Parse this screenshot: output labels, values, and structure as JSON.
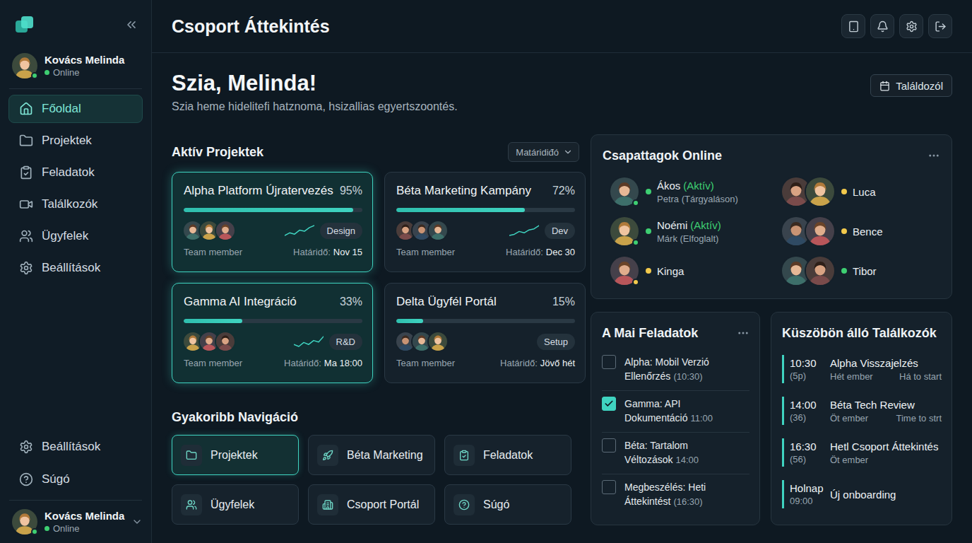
{
  "header": {
    "title": "Csoport Áttekintés"
  },
  "sidebar": {
    "user": {
      "name": "Kovács Melinda",
      "status": "Online",
      "online": true
    },
    "items": [
      {
        "label": "Főoldal",
        "selected": true
      },
      {
        "label": "Projektek",
        "selected": false
      },
      {
        "label": "Feladatok",
        "selected": false
      },
      {
        "label": "Találkozók",
        "selected": false
      },
      {
        "label": "Ügyfelek",
        "selected": false
      },
      {
        "label": "Beállítások",
        "selected": false
      }
    ],
    "bottom_items": [
      {
        "label": "Beállítások"
      },
      {
        "label": "Súgó"
      }
    ],
    "footer_user": {
      "name": "Kovács Melinda",
      "status": "Online",
      "online": true
    }
  },
  "greeting": {
    "title": "Szia, Melinda!",
    "subtitle": "Szia heme hidelitefi hatznoma, hsizallias egyertszoontés.",
    "button": "Találdozól"
  },
  "projects": {
    "title": "Aktív Projektek",
    "filter": "Matáridiđó",
    "items": [
      {
        "name": "Alpha Platform Újratervezés",
        "percent": "95%",
        "level": 0.95,
        "tag": "Design",
        "member_label": "Team member",
        "deadline_label": "Határidő:",
        "deadline": "Nov 15",
        "highlighted": true,
        "avatars": 3,
        "sparkline": [
          3,
          4,
          3.5,
          5,
          4.6,
          6,
          6.8
        ]
      },
      {
        "name": "Béta Marketing Kampány",
        "percent": "72%",
        "level": 0.72,
        "tag": "Dev",
        "member_label": "Team member",
        "deadline_label": "Határidő:",
        "deadline": "Dec 30",
        "highlighted": false,
        "avatars": 3,
        "sparkline": [
          2,
          2.5,
          3.8,
          3.2,
          4.5,
          5,
          6.5
        ]
      },
      {
        "name": "Gamma AI Integráció",
        "percent": "33%",
        "level": 0.33,
        "tag": "R&D",
        "member_label": "Team member",
        "deadline_label": "Határidő:",
        "deadline": "Ma 18:00",
        "highlighted": true,
        "avatars": 3,
        "sparkline": [
          3,
          2.5,
          3.5,
          3,
          4,
          3.6,
          5
        ]
      },
      {
        "name": "Delta Ügyfél Portál",
        "percent": "15%",
        "level": 0.15,
        "tag": "Setup",
        "member_label": "Team member",
        "deadline_label": "Határidő:",
        "deadline": "Jövő hét",
        "highlighted": false,
        "avatars": 3,
        "sparkline": []
      }
    ]
  },
  "quick_nav": {
    "title": "Gyakoribb Navigáció",
    "items": [
      {
        "label": "Projektek",
        "selected": true
      },
      {
        "label": "Béta Marketing",
        "selected": false
      },
      {
        "label": "Feladatok",
        "selected": false
      },
      {
        "label": "Ügyfelek",
        "selected": false
      },
      {
        "label": "Csoport Portál",
        "selected": false
      },
      {
        "label": "Súgó",
        "selected": false
      }
    ]
  },
  "team": {
    "title": "Csapattagok Online",
    "members": [
      {
        "name": "Ákos",
        "status": "(Aktív)",
        "sub": "Petra (Tárgyaláson)",
        "avatars": 1,
        "color": "#3ecf72"
      },
      {
        "name": "Noémi",
        "status": "(Aktív)",
        "sub": "Márk (Elfoglalt)",
        "avatars": 1,
        "color": "#3ecf72"
      },
      {
        "name": "Kinga",
        "avatars": 1,
        "color": "#f2c94c"
      },
      {
        "name": "Luca",
        "avatars": 2,
        "color": "#f2c94c"
      },
      {
        "name": "Bence",
        "avatars": 2,
        "color": "#f2c94c"
      },
      {
        "name": "Tibor",
        "avatars": 2,
        "color": "#3ecf72"
      }
    ]
  },
  "tasks": {
    "title": "A Mai Feladatok",
    "items": [
      {
        "title": "Alpha: Mobil Verzió Ellenőrzés",
        "time": "(10:30)",
        "checked": false
      },
      {
        "title": "Gamma: API Dokumentáció",
        "time": "11:00",
        "checked": true
      },
      {
        "title": "Béta: Tartalom Véltozások",
        "time": "14:00",
        "checked": false
      },
      {
        "title": "Megbeszélés: Heti Áttekintést",
        "time": "(16:30)",
        "checked": false
      }
    ]
  },
  "meetings": {
    "title": "Küszöbön álló Találkozók",
    "items": [
      {
        "time": "10:30",
        "note": "(5p)",
        "title": "Alpha Visszajelzés",
        "people": "Hét ember",
        "countdown": "Há to start"
      },
      {
        "time": "14:00",
        "note": "(36)",
        "title": "Béta Tech Review",
        "people": "Öt ember",
        "countdown": "Time to strt"
      },
      {
        "time": "16:30",
        "note": "(56)",
        "title": "Hetl Csoport Áttekintés",
        "people": "Öt ember"
      },
      {
        "time": "Holnap",
        "note": "09:00",
        "title": "Új onboarding"
      }
    ]
  }
}
